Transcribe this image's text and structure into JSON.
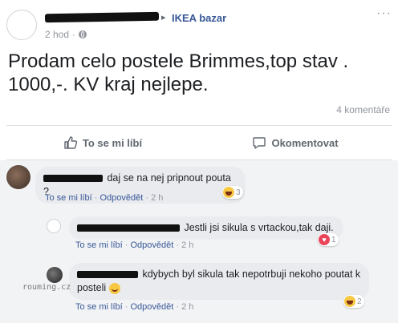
{
  "post": {
    "group_arrow": "▸",
    "group": "IKEA bazar",
    "time": "2 hod",
    "more": "···",
    "text": "Prodam celo postele Brimmes,top stav . 1000,-. KV kraj nejlepe.",
    "comment_count": "4 komentáře"
  },
  "actions": {
    "like": "To se mi líbí",
    "comment": "Okomentovat"
  },
  "comments": [
    {
      "text": "daj se na nej pripnout pouta ?",
      "like": "To se mi líbí",
      "reply": "Odpovědět",
      "time": "2 h",
      "reaction_count": "3",
      "reaction": "haha-icon"
    },
    {
      "text": "Jestli jsi sikula s vrtackou,tak daji.",
      "like": "To se mi líbí",
      "reply": "Odpovědět",
      "time": "2 h",
      "reaction_count": "1",
      "reaction": "love-icon"
    },
    {
      "text": "kdybych byl sikula tak nepotrbuji nekoho poutat k posteli",
      "like": "To se mi líbí",
      "reply": "Odpovědět",
      "time": "2 h",
      "reaction_count": "2",
      "reaction": "haha-icon"
    }
  ],
  "watermark": "rouming.cz",
  "colors": {
    "link": "#385898",
    "muted": "#90949c",
    "bubble": "#e9ebee",
    "comments_bg": "#f2f3f5"
  }
}
